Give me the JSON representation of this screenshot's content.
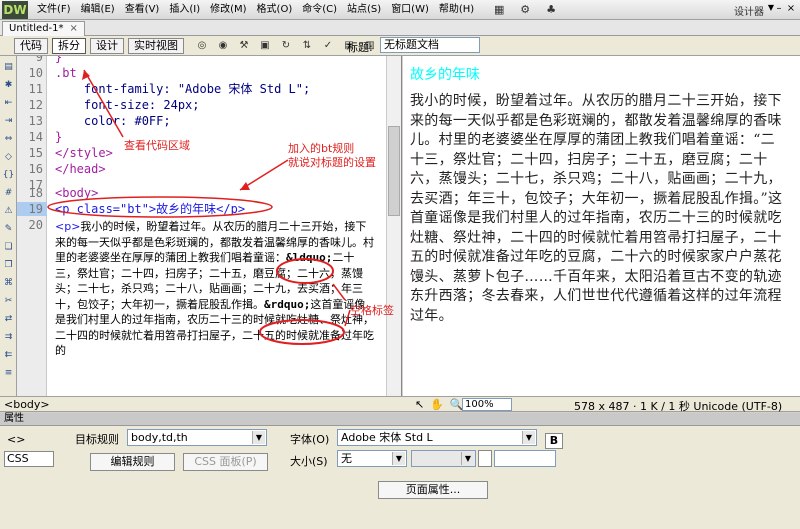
{
  "app": {
    "logo": "DW",
    "menu": [
      "文件(F)",
      "编辑(E)",
      "查看(V)",
      "插入(I)",
      "修改(M)",
      "格式(O)",
      "命令(C)",
      "站点(S)",
      "窗口(W)",
      "帮助(H)"
    ],
    "workspace_label": "设计器",
    "menu_icons": [
      "layout-icon",
      "settings-icon",
      "extend-icon"
    ]
  },
  "document": {
    "tab_label": "Untitled-1*",
    "close_glyph": "×"
  },
  "toolbar": {
    "code_label": "代码",
    "split_label": "拆分",
    "design_label": "设计",
    "live_label": "实时视图",
    "title_label": "标题:",
    "title_value": "无标题文档"
  },
  "code": {
    "lines": [
      {
        "no": "9",
        "text": "}"
      },
      {
        "no": "10",
        "text": ".bt"
      },
      {
        "no": "11",
        "text": "    font-family: \"Adobe 宋体 Std L\";"
      },
      {
        "no": "12",
        "text": "    font-size: 24px;"
      },
      {
        "no": "13",
        "text": "    color: #0FF;"
      },
      {
        "no": "14",
        "text": "}"
      },
      {
        "no": "15",
        "text": "</style>"
      },
      {
        "no": "16",
        "text": "</head>"
      },
      {
        "no": "17",
        "text": ""
      },
      {
        "no": "18",
        "text": "<body>"
      },
      {
        "no": "19",
        "text": "<p class=\"bt\">故乡的年味</p>"
      },
      {
        "no": "20",
        "text": ""
      }
    ],
    "para_open": "<p>",
    "para_text_1": "我小的时候，盼望着过年。从农历的腊月二十三开始，接下来的每一天似乎都是色彩斑斓的，都散发着温馨绵厚的香味儿。村里的老婆婆坐在厚厚的蒲团上教我们唱着童谣：",
    "entity_open": "&ldquo;",
    "para_text_2": "二十三，祭灶官；二十四，扫房子；二十五，磨豆腐；二十六，蒸馒头；二十七，杀只鸡；二十八，贴画画；二十九，去买酒；年三十，包饺子；大年初一，撅着屁股乱作揖。",
    "entity_close": "&rdquo;",
    "para_text_3": "这首童谣像是我们村里人的过年指南，农历二十三的时候就吃灶糖、祭灶神，二十四的时候就忙着用笤帚打扫屋子，二十五的时候就准备过年吃的"
  },
  "design": {
    "title": "故乡的年味",
    "body": "我小的时候，盼望着过年。从农历的腊月二十三开始，接下来的每一天似乎都是色彩斑斓的，都散发着温馨绵厚的香味儿。村里的老婆婆坐在厚厚的蒲团上教我们唱着童谣：“二十三，祭灶官；二十四，扫房子；二十五，磨豆腐；二十六，蒸馒头；二十七，杀只鸡；二十八，贴画画；二十九，去买酒；年三十，包饺子；大年初一，撅着屁股乱作揖。”这首童谣像是我们村里人的过年指南，农历二十三的时候就吃灶糖、祭灶神，二十四的时候就忙着用笤帚打扫屋子，二十五的时候就准备过年吃的豆腐，二十六的时候家家户户蒸花馒头、蒸萝卜包子……千百年来，太阳沿着亘古不变的轨迹东升西落；冬去春来，人们世世代代遵循着这样的过年流程过年。"
  },
  "status": {
    "tag": "<body>",
    "zoom": "100%",
    "size": "578 x 487",
    "weight": "1 K / 1 秒",
    "encoding": "Unicode (UTF-8)"
  },
  "properties": {
    "header": "属性",
    "html_label": "<> HTML",
    "css_label": "CSS",
    "target_rule_label": "目标规则",
    "target_rule_value": "body,td,th",
    "edit_rule_label": "编辑规则",
    "css_panel_label": "CSS 面板(P)",
    "font_label": "字体(O)",
    "font_value": "Adobe 宋体 Std L",
    "bold_label": "B",
    "size_label": "大小(S)",
    "size_value": "无",
    "page_props_label": "页面属性..."
  },
  "annotations": {
    "view_code": "查看代码区域",
    "bt_rule_line1": "加入的bt规则",
    "bt_rule_line2": "就说对标题的设置",
    "space_tag": "空格标签",
    "color": "#e02020"
  }
}
